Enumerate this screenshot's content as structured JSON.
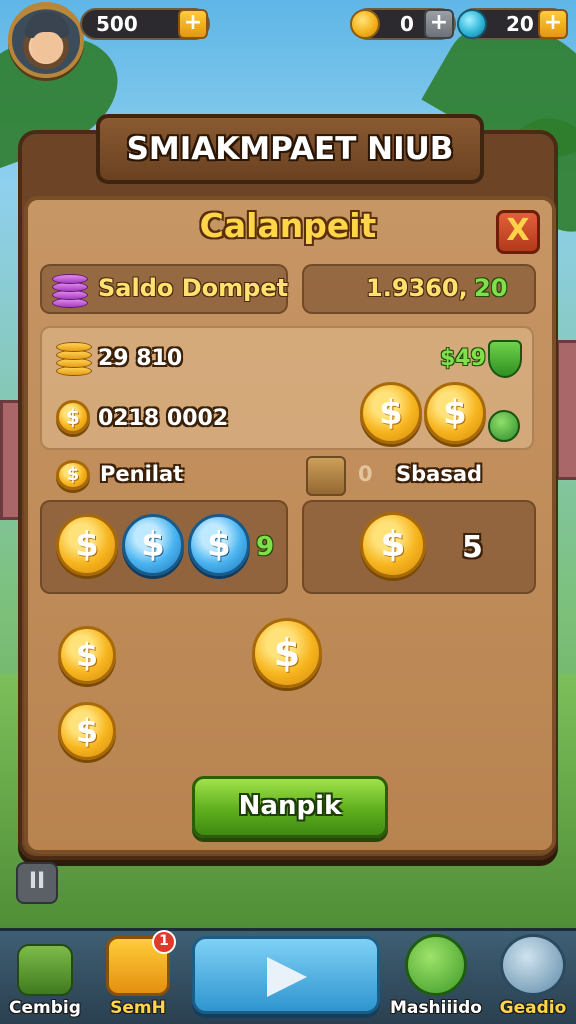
{
  "hud": {
    "gold_amount": "500",
    "coin_count": "0",
    "gem_count": "20",
    "plus_symbol": "+"
  },
  "window": {
    "banner_title": "SMIAKMPAET NIUB",
    "title": "Calanpeit",
    "close_symbol": "X"
  },
  "wallet": {
    "label": "Saldo Dompet",
    "balance_a": "1.9360,",
    "balance_b": "20"
  },
  "rewards": {
    "row1_amount": "29 810",
    "row1_bonus": "$49",
    "row2_amount": "0218 0002"
  },
  "sections": {
    "left_label": "Penilat",
    "right_label": "Sbasad",
    "right_faded_value": "0",
    "left_count": "9",
    "right_count": "5"
  },
  "action_button": "Nanpik",
  "pause_label": "II",
  "nav": {
    "items": [
      {
        "label": "Cembig"
      },
      {
        "label": "SemH",
        "badge": "1"
      },
      {
        "label": "Mashiiido"
      },
      {
        "label": "Geadio"
      }
    ]
  },
  "colors": {
    "accent_gold": "#f7b51f",
    "button_green": "#5fae1e",
    "panel_brown": "#b8834f"
  }
}
